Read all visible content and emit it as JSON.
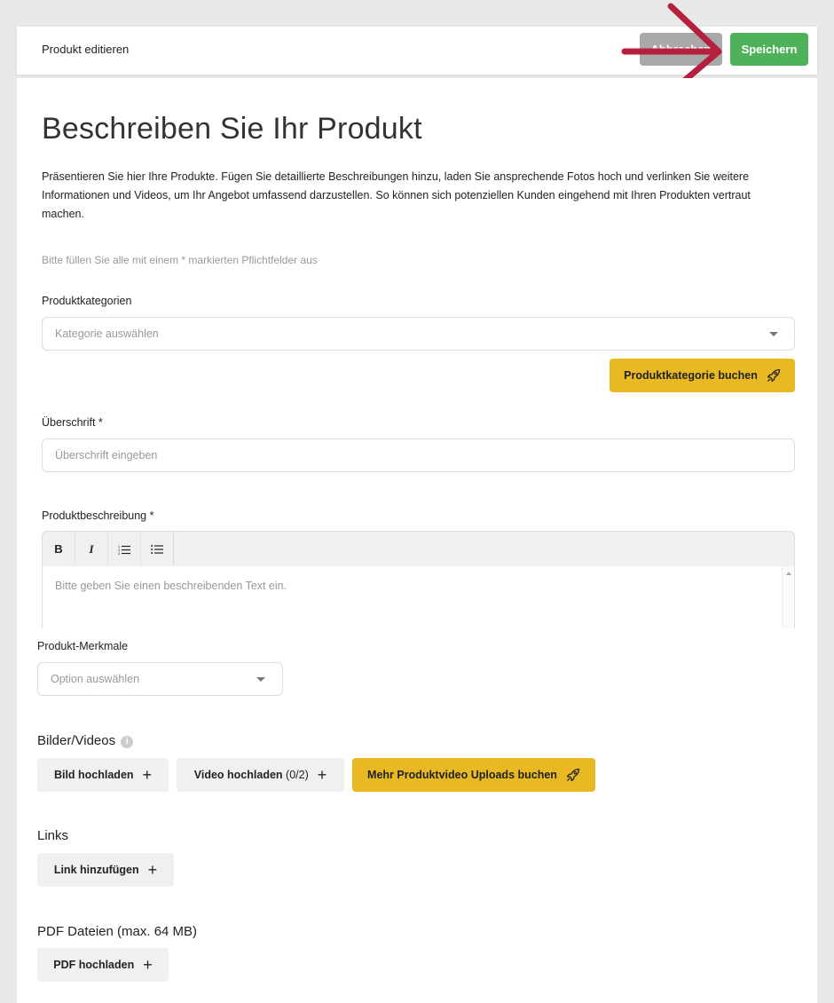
{
  "header": {
    "title": "Produkt editieren",
    "cancel_label": "Abbrechen",
    "save_label": "Speichern"
  },
  "page": {
    "heading": "Beschreiben Sie Ihr Produkt",
    "intro": "Präsentieren Sie hier Ihre Produkte. Fügen Sie detaillierte Beschreibungen hinzu, laden Sie ansprechende Fotos hoch und verlinken Sie weitere Informationen und Videos, um Ihr Angebot umfassend darzustellen. So können sich potenziellen Kunden eingehend mit Ihren Produkten vertraut machen.",
    "required_hint": "Bitte füllen Sie alle mit einem * markierten Pflichtfelder aus"
  },
  "categories": {
    "label": "Produktkategorien",
    "placeholder": "Kategorie auswählen",
    "book_button": "Produktkategorie buchen"
  },
  "headline": {
    "label": "Überschrift *",
    "placeholder": "Überschrift eingeben"
  },
  "description": {
    "label": "Produktbeschreibung *",
    "toolbar": [
      "B",
      "I",
      "ordered-list",
      "bullet-list"
    ],
    "placeholder": "Bitte geben Sie einen beschreibenden Text ein."
  },
  "features": {
    "label": "Produkt-Merkmale",
    "placeholder": "Option auswählen"
  },
  "media": {
    "title": "Bilder/Videos",
    "image_button": "Bild hochladen",
    "video_button": "Video hochladen",
    "video_count": "(0/2)",
    "book_button": "Mehr Produktvideo Uploads buchen"
  },
  "links": {
    "title": "Links",
    "add_button": "Link hinzufügen"
  },
  "pdf": {
    "title": "PDF Dateien (max. 64 MB)",
    "upload_button": "PDF hochladen"
  },
  "colors": {
    "save": "#4fb25b",
    "cancel": "#a9a9a9",
    "accent_yellow": "#e8b923",
    "annotation_arrow": "#b5203f"
  }
}
